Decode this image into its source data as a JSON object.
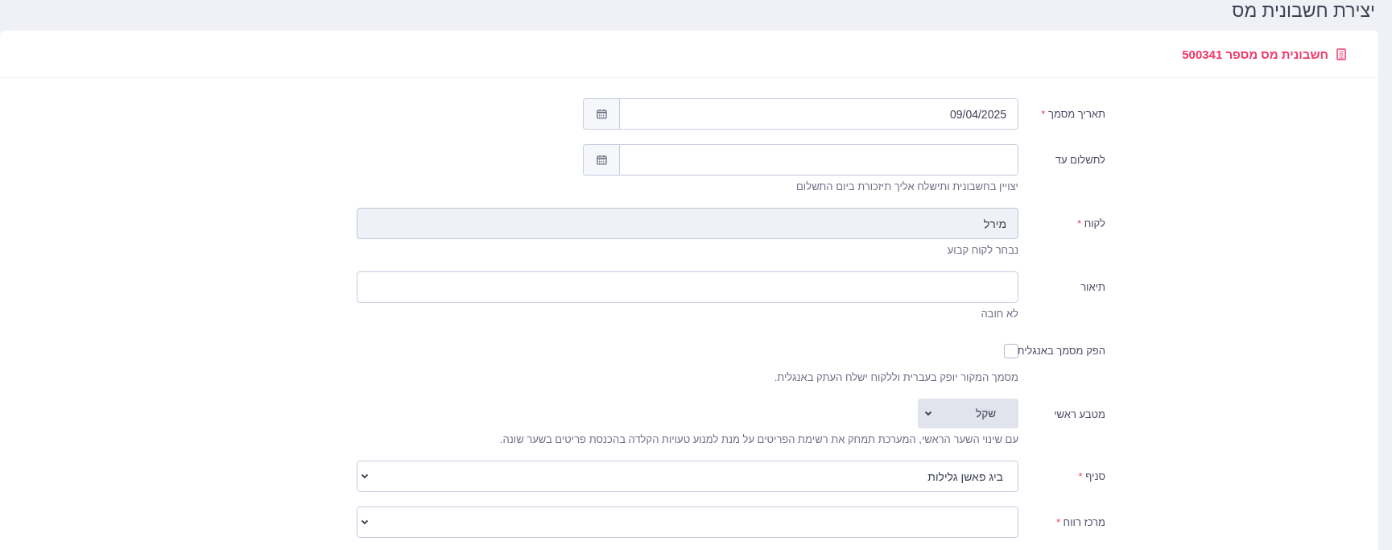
{
  "page_title": "יצירת חשבונית מס",
  "card_header": {
    "title": "חשבונית מס מספר 500341"
  },
  "fields": [
    {
      "kind": "date",
      "label": "תאריך מסמך",
      "required_mark": "*",
      "value": "09/04/2025"
    },
    {
      "kind": "date",
      "label": "לתשלום עד",
      "help": "יצויין בחשבונית ותישלח אליך תיזכורת ביום התשלום"
    },
    {
      "kind": "text",
      "label": "לקוח",
      "required_mark": "*",
      "value": "מירל",
      "disabled": true,
      "help": "נבחר לקוח קבוע"
    },
    {
      "kind": "text",
      "label": "תיאור",
      "disabled": false,
      "help": "לא חובה"
    },
    {
      "kind": "checkbox",
      "label": "הפק מסמך באנגלית",
      "checked": false,
      "help": "מסמך המקור יופק בעברית וללקוח ישלח העתק באנגלית."
    },
    {
      "kind": "currency",
      "label": "מטבע ראשי",
      "value": "שקל",
      "help": "עם שינוי השער הראשי, המערכת תמחק את רשימת הפריטים על מנת למנוע טעויות הקלדה בהכנסת פריטים בשער שונה."
    },
    {
      "kind": "select",
      "label": "סניף",
      "required_mark": "*",
      "value": "ביג פאשן גלילות"
    },
    {
      "kind": "select",
      "label": "מרכז רווח",
      "required_mark": "*"
    }
  ]
}
